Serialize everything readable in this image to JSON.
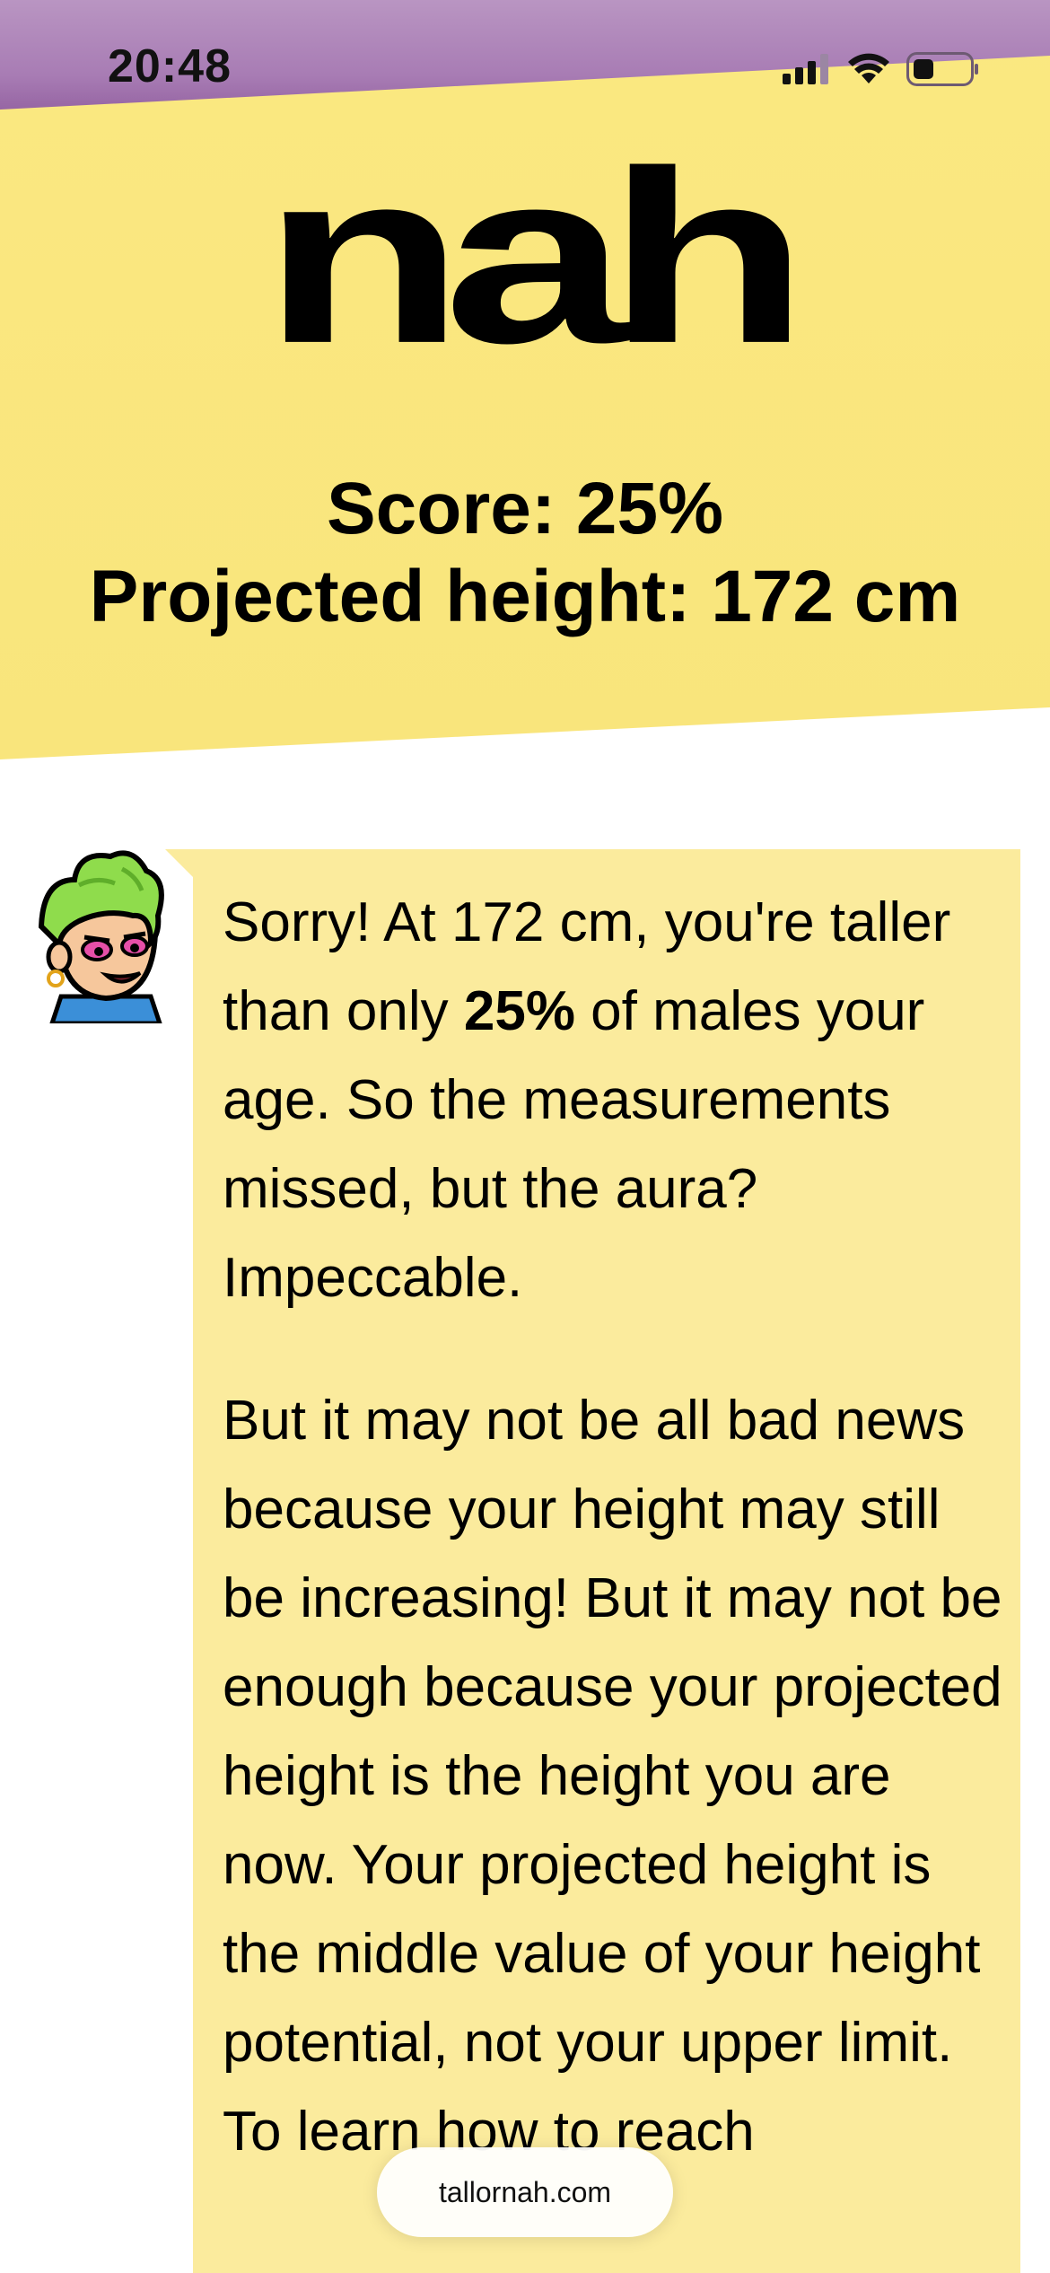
{
  "status_bar": {
    "time": "20:48",
    "icons": [
      "cellular-signal-icon",
      "wifi-icon",
      "battery-icon"
    ]
  },
  "hero": {
    "brand": "nah",
    "score_line": "Score: 25%",
    "projected_line": "Projected height: 172 cm"
  },
  "message": {
    "p1_before": "Sorry! At 172 cm, you're taller than only ",
    "p1_bold": "25%",
    "p1_after": " of males your age. So the measurements missed, but the aura? Impeccable.",
    "p2": "But it may not be all bad news because your height may still be increasing! But it may not be enough because your projected height is the height you are now. Your projected height is the middle value of your height potential, not your upper limit. To learn how to reach"
  },
  "browser": {
    "url": "tallornah.com"
  },
  "colors": {
    "status_purple": "#a87cb4",
    "hero_yellow": "#f9e57c",
    "bubble_yellow": "#fbeb9d"
  }
}
